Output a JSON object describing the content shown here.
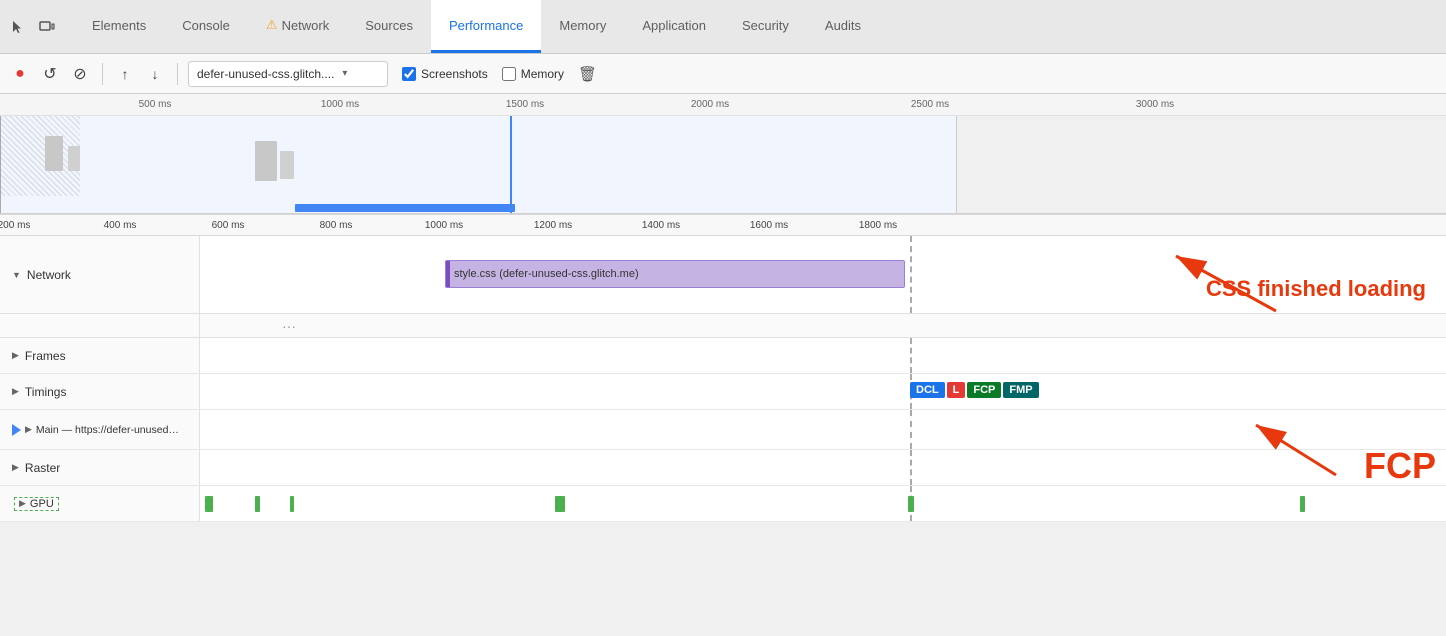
{
  "tabs": [
    {
      "id": "elements",
      "label": "Elements",
      "active": false,
      "warn": false
    },
    {
      "id": "console",
      "label": "Console",
      "active": false,
      "warn": false
    },
    {
      "id": "network",
      "label": "Network",
      "active": false,
      "warn": true
    },
    {
      "id": "sources",
      "label": "Sources",
      "active": false,
      "warn": false
    },
    {
      "id": "performance",
      "label": "Performance",
      "active": true,
      "warn": false
    },
    {
      "id": "memory",
      "label": "Memory",
      "active": false,
      "warn": false
    },
    {
      "id": "application",
      "label": "Application",
      "active": false,
      "warn": false
    },
    {
      "id": "security",
      "label": "Security",
      "active": false,
      "warn": false
    },
    {
      "id": "audits",
      "label": "Audits",
      "active": false,
      "warn": false
    }
  ],
  "toolbar": {
    "record_label": "●",
    "reload_label": "↺",
    "stop_label": "⊘",
    "upload_label": "↑",
    "download_label": "↓",
    "url_text": "defer-unused-css.glitch....",
    "screenshots_label": "Screenshots",
    "memory_label": "Memory",
    "trash_label": "🗑"
  },
  "top_ruler": {
    "ticks": [
      "500 ms",
      "1000 ms",
      "1500 ms",
      "2000 ms",
      "2500 ms",
      "3000 ms"
    ]
  },
  "bottom_ruler": {
    "ticks": [
      "200 ms",
      "400 ms",
      "600 ms",
      "800 ms",
      "1000 ms",
      "1200 ms",
      "1400 ms",
      "1600 ms",
      "1800 ms"
    ]
  },
  "network_section": {
    "label": "Network",
    "css_bar_text": "style.css (defer-unused-css.glitch.me)",
    "annotation": "CSS finished loading"
  },
  "tracks": [
    {
      "id": "frames",
      "label": "Frames",
      "has_triangle": true
    },
    {
      "id": "timings",
      "label": "Timings",
      "has_triangle": true,
      "badges": [
        "DCL",
        "L",
        "FCP",
        "FMP"
      ]
    },
    {
      "id": "main",
      "label": "Main — https://defer-unused-css.glitch.me/index-unoptimized.html",
      "has_triangle": true
    },
    {
      "id": "raster",
      "label": "Raster",
      "has_triangle": true
    },
    {
      "id": "gpu",
      "label": "GPU",
      "has_triangle": true
    }
  ],
  "fcp_annotation": "FCP",
  "badge_colors": {
    "DCL": "#1a73e8",
    "L": "#e53935",
    "FCP": "#0a7a27",
    "FMP": "#006666"
  }
}
